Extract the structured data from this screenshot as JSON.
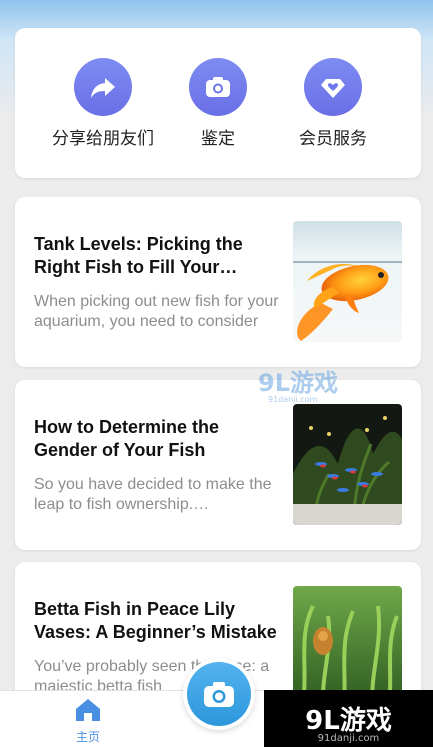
{
  "quick_actions": [
    {
      "label": "分享给朋友们",
      "icon": "share-arrow-icon"
    },
    {
      "label": "鉴定",
      "icon": "camera-icon"
    },
    {
      "label": "会员服务",
      "icon": "vip-heart-icon"
    }
  ],
  "articles": [
    {
      "title": "Tank Levels: Picking the Right Fish to Fill Your Aquarium",
      "excerpt": "When picking out new fish for your aquarium, you need to consider",
      "thumb": "goldfish-photo"
    },
    {
      "title": "How to Determine the Gender of Your Fish",
      "excerpt": "So you have decided to make the leap to fish ownership. Congratulations",
      "thumb": "aquarium-tetras-photo"
    },
    {
      "title": "Betta Fish in Peace Lily Vases: A Beginner’s Mistake",
      "excerpt": "You’ve probably seen the vase: a majestic betta fish",
      "thumb": "plants-photo"
    }
  ],
  "bottom_nav": {
    "home_label": "主页",
    "home_icon": "home-icon",
    "fab_icon": "camera-icon"
  },
  "watermark": {
    "text": "9L游戏",
    "sub": "91danji.com",
    "center_text": "9L游戏",
    "center_sub": "91danji.com"
  },
  "colors": {
    "accent_purple": "#6a6fe6",
    "accent_blue": "#2d97dc",
    "nav_active": "#4a90e2"
  }
}
